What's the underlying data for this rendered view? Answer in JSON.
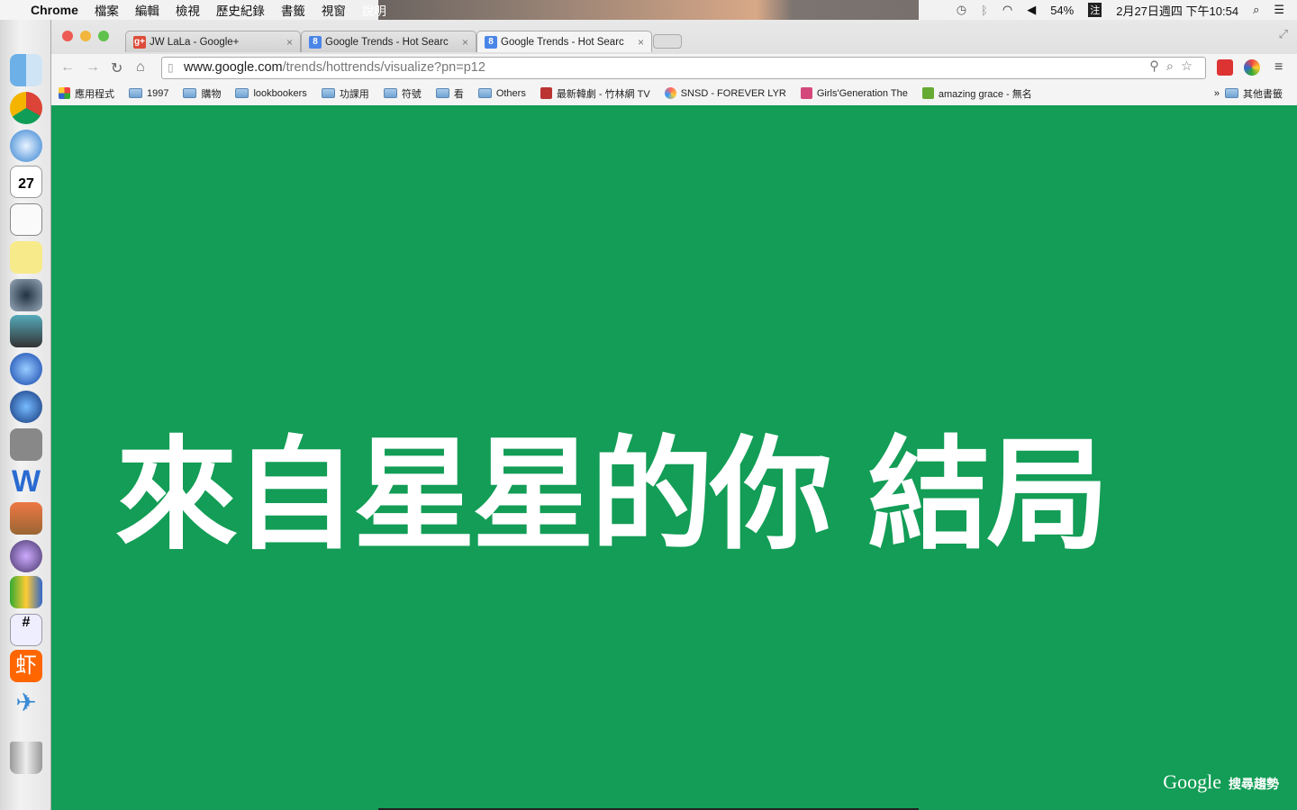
{
  "menubar": {
    "app": "Chrome",
    "menus": [
      "檔案",
      "編輯",
      "檢視",
      "歷史紀錄",
      "書籤",
      "視窗",
      "說明"
    ],
    "battery": "54%",
    "input_method": "注",
    "datetime": "2月27日週四 下午10:54"
  },
  "tabs": [
    {
      "title": "JW LaLa - Google+",
      "favicon": "g+",
      "color": "#dd4b39",
      "active": false
    },
    {
      "title": "Google Trends - Hot Searc",
      "favicon": "8",
      "color": "#4a86e8",
      "active": false
    },
    {
      "title": "Google Trends - Hot Searc",
      "favicon": "8",
      "color": "#4a86e8",
      "active": true
    }
  ],
  "address": {
    "host": "www.google.com",
    "path": "/trends/hottrends/visualize?pn=p12"
  },
  "bookmarks": [
    {
      "label": "應用程式",
      "icon": "apps"
    },
    {
      "label": "1997",
      "icon": "folder"
    },
    {
      "label": "購物",
      "icon": "folder"
    },
    {
      "label": "lookbookers",
      "icon": "folder"
    },
    {
      "label": "功課用",
      "icon": "folder"
    },
    {
      "label": "符號",
      "icon": "folder"
    },
    {
      "label": "看",
      "icon": "folder"
    },
    {
      "label": "Others",
      "icon": "folder"
    },
    {
      "label": "最新韓劇 - 竹林網 TV",
      "icon": "tv"
    },
    {
      "label": "SNSD - FOREVER LYR",
      "icon": "snsd"
    },
    {
      "label": "Girls'Generation The",
      "icon": "pink"
    },
    {
      "label": "amazing grace - 無名",
      "icon": "green"
    }
  ],
  "bookmarks_more": "»",
  "other_bookmarks": "其他書籤",
  "main": {
    "headline": "來自星星的你 結局",
    "brand_google": "Google",
    "brand_trends": "搜尋趨勢",
    "background": "#139d56"
  }
}
